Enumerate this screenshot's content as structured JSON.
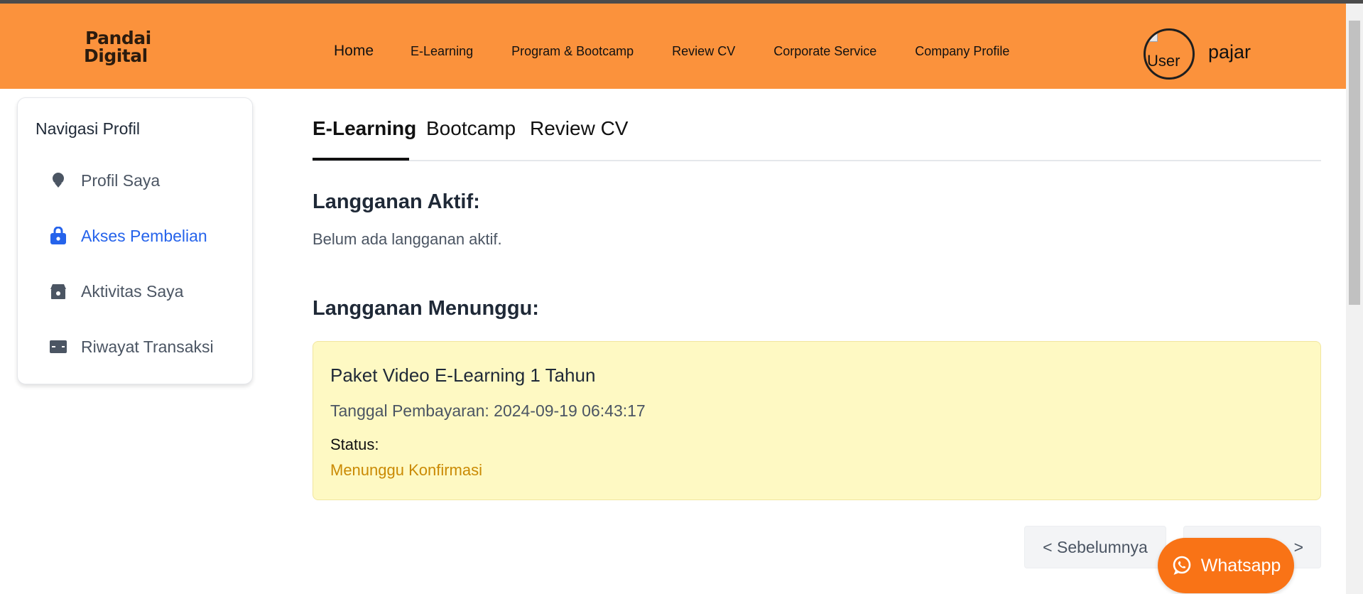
{
  "brand": {
    "logo_line1": "Pandai",
    "logo_line2": "Digital"
  },
  "nav": {
    "items": [
      "Home",
      "E-Learning",
      "Program & Bootcamp",
      "Review CV",
      "Corporate Service",
      "Company Profile"
    ]
  },
  "user": {
    "avatar_alt": "User",
    "name": "pajar"
  },
  "sidebar": {
    "title": "Navigasi Profil",
    "items": [
      {
        "label": "Profil Saya",
        "icon": "user-icon"
      },
      {
        "label": "Akses Pembelian",
        "icon": "lock-icon",
        "active": true
      },
      {
        "label": "Aktivitas Saya",
        "icon": "store-icon"
      },
      {
        "label": "Riwayat Transaksi",
        "icon": "credit-card-icon"
      }
    ]
  },
  "tabs": [
    "E-Learning",
    "Bootcamp",
    "Review CV"
  ],
  "main": {
    "active_heading": "Langganan Aktif:",
    "active_empty": "Belum ada langganan aktif.",
    "waiting_heading": "Langganan Menunggu:"
  },
  "pending": {
    "title": "Paket Video E-Learning 1 Tahun",
    "payment_date": "Tanggal Pembayaran: 2024-09-19 06:43:17",
    "status_label": "Status:",
    "status": "Menunggu Konfirmasi"
  },
  "pagination": {
    "prev": "< Sebelumnya",
    "next": ">"
  },
  "whatsapp": {
    "label": "Whatsapp"
  },
  "colors": {
    "header": "#fb923c",
    "active_link": "#2563eb",
    "pending_bg": "#fef9c3",
    "status": "#ca8a04",
    "whatsapp": "#f97316"
  }
}
